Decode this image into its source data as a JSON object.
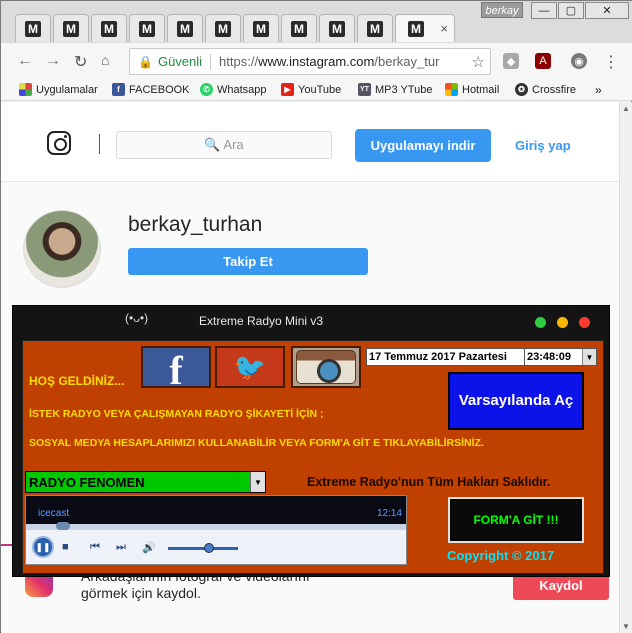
{
  "browser": {
    "profile_name": "berkay",
    "tab_icon_letter": "M",
    "tab_close": "×",
    "win_minimize": "—",
    "win_maximize": "▢",
    "win_close": "✕",
    "nav_back": "←",
    "nav_forward": "→",
    "nav_reload": "↻",
    "secure_label": "Güvenli",
    "url_scheme": "https://",
    "url_host": "www.instagram.com",
    "url_path": "/berkay_tur",
    "star": "☆",
    "menu": "⋮"
  },
  "bookmarks": [
    {
      "label": "Uygulamalar",
      "color": "#d44"
    },
    {
      "label": "FACEBOOK",
      "color": "#3b5998",
      "glyph": "f"
    },
    {
      "label": "Whatsapp",
      "color": "#25d366",
      "glyph": "✆"
    },
    {
      "label": "YouTube",
      "color": "#e62117",
      "glyph": "▶"
    },
    {
      "label": "MP3 YTube",
      "color": "#556",
      "glyph": "YT"
    },
    {
      "label": "Hotmail",
      "color": "#f25022",
      "glyph": "■"
    },
    {
      "label": "Crossfire",
      "color": "#333",
      "glyph": "✪"
    },
    {
      "label": "»"
    }
  ],
  "instagram": {
    "search_placeholder": "🔍 Ara",
    "get_app": "Uygulamayı indir",
    "login": "Giriş yap",
    "username": "berkay_turhan",
    "follow": "Takip Et",
    "footer_text": "Arkadaşlarının fotoğraf ve videolarını görmek için kaydol.",
    "signup": "Kaydol"
  },
  "radio": {
    "face": "(•ᴗ•)",
    "title": "Extreme Radyo Mini v3",
    "dots": [
      "#2ecc40",
      "#f5b700",
      "#ff3b30"
    ],
    "welcome": "HOŞ GELDİNİZ...",
    "facebook": "f",
    "twitter": "🐦",
    "date": "17 Temmuz 2017  Pazartesi",
    "time": "23:48:09",
    "default_button": "Varsayılanda Aç",
    "line1": "İSTEK RADYO VEYA ÇALIŞMAYAN RADYO ŞİKAYETİ İÇİN ;",
    "line2": "SOSYAL MEDYA HESAPLARIMIZI KULLANABİLİR VEYA FORM'A GİT E TIKLAYABİLİRSİNİZ.",
    "station": "RADYO FENOMEN",
    "rights": "Extreme Radyo'nun Tüm Hakları Saklıdır.",
    "player_name": "icecast",
    "player_time": "12:14",
    "form_button": "FORM'A GİT !!!",
    "copyright": "Copyright ©  2017"
  }
}
